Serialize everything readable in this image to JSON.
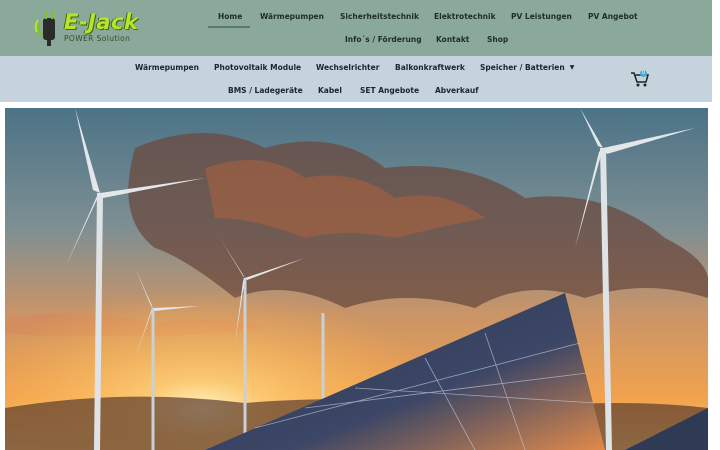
{
  "brand": {
    "name": "E-Jack",
    "tagline": "POWER Solution",
    "logo_colors": {
      "primary": "#b9e22a",
      "outline": "#3c6b12"
    }
  },
  "top_nav": {
    "items": [
      {
        "label": "Home",
        "active": true
      },
      {
        "label": "Wärmepumpen"
      },
      {
        "label": "Sicherheitstechnik"
      },
      {
        "label": "Elektrotechnik"
      },
      {
        "label": "PV Leistungen"
      },
      {
        "label": "PV Angebot"
      },
      {
        "label": "Info´s / Förderung"
      },
      {
        "label": "Kontakt"
      },
      {
        "label": "Shop"
      }
    ]
  },
  "sub_nav": {
    "items": [
      {
        "label": "Wärmepumpen"
      },
      {
        "label": "Photovoltaik Module"
      },
      {
        "label": "Wechselrichter"
      },
      {
        "label": "Balkonkraftwerk"
      },
      {
        "label": "Speicher / Batterien",
        "has_dropdown": true
      },
      {
        "label": "BMS / Ladegeräte"
      },
      {
        "label": "Kabel"
      },
      {
        "label": "SET Angebote"
      },
      {
        "label": "Abverkauf"
      }
    ]
  },
  "cart": {
    "icon": "cart-icon",
    "count": "0"
  },
  "hero": {
    "image": "wind-turbines-and-solar-panels-at-sunset"
  },
  "colors": {
    "header_bg": "#8aa99b",
    "subnav_bg": "#c5d3dc"
  }
}
